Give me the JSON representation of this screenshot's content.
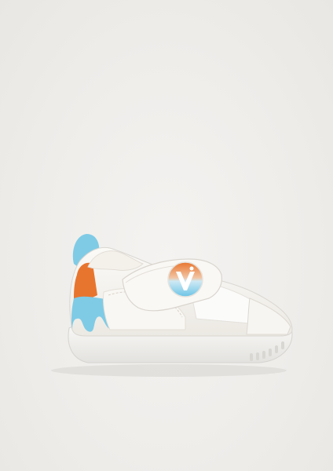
{
  "image": {
    "subject": "product-photo",
    "colors": {
      "background": "#efedea",
      "upper": "#f7f5f1",
      "sole": "#f3f2ef",
      "accent_blue": "#7fcbe6",
      "accent_orange": "#e8752e"
    }
  }
}
